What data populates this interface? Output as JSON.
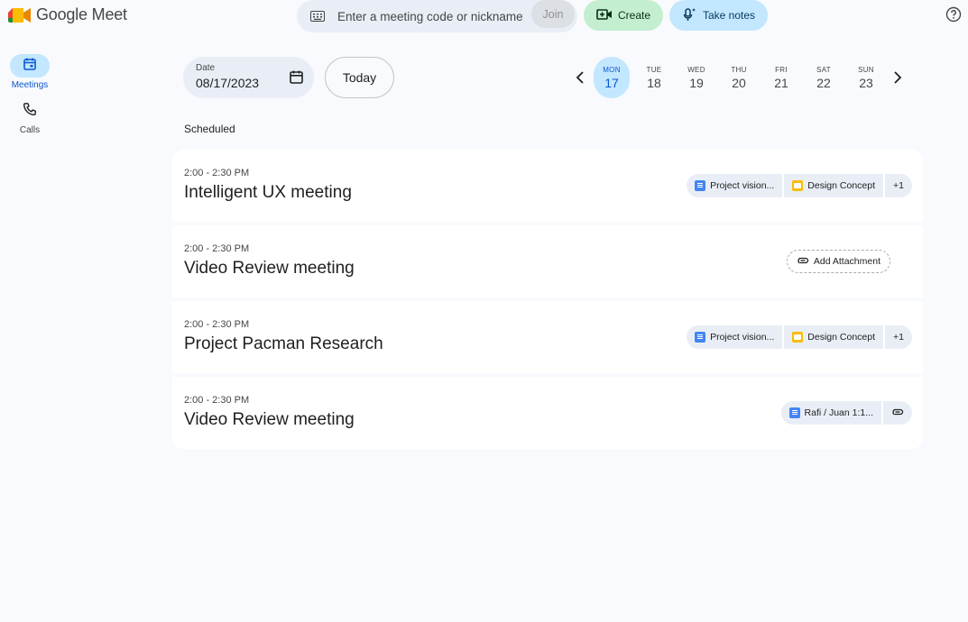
{
  "app": {
    "brand_name": "Google Meet"
  },
  "search": {
    "placeholder": "Enter a meeting code or nickname",
    "join_label": "Join"
  },
  "actions": {
    "create_label": "Create",
    "notes_label": "Take notes"
  },
  "nav": {
    "items": [
      {
        "label": "Meetings",
        "icon": "calendar-icon",
        "active": true
      },
      {
        "label": "Calls",
        "icon": "phone-icon",
        "active": false
      }
    ]
  },
  "date_field": {
    "label": "Date",
    "value": "08/17/2023"
  },
  "today_label": "Today",
  "week": {
    "days": [
      {
        "name": "MON",
        "num": "17",
        "selected": true
      },
      {
        "name": "TUE",
        "num": "18"
      },
      {
        "name": "WED",
        "num": "19"
      },
      {
        "name": "THU",
        "num": "20"
      },
      {
        "name": "FRI",
        "num": "21"
      },
      {
        "name": "SAT",
        "num": "22"
      },
      {
        "name": "SUN",
        "num": "23"
      }
    ]
  },
  "section_title": "Scheduled",
  "meetings": [
    {
      "time": "2:00 - 2:30 PM",
      "title": "Intelligent UX meeting",
      "attachments": [
        {
          "icon": "doc",
          "label": "Project vision..."
        },
        {
          "icon": "slides",
          "label": "Design Concept"
        }
      ],
      "more": "+1"
    },
    {
      "time": "2:00 - 2:30 PM",
      "title": "Video Review meeting",
      "add_attachment": "Add Attachment"
    },
    {
      "time": "2:00 - 2:30 PM",
      "title": "Project Pacman Research",
      "attachments": [
        {
          "icon": "doc",
          "label": "Project vision..."
        },
        {
          "icon": "slides",
          "label": "Design Concept"
        }
      ],
      "more": "+1"
    },
    {
      "time": "2:00 - 2:30 PM",
      "title": "Video Review meeting",
      "attachments": [
        {
          "icon": "doc",
          "label": "Rafi / Juan 1:1..."
        }
      ]
    }
  ],
  "colors": {
    "accent": "#0b57d0",
    "selected_bg": "#c2e7ff",
    "create_bg": "#c4eed0",
    "surface": "#e9eef6"
  }
}
